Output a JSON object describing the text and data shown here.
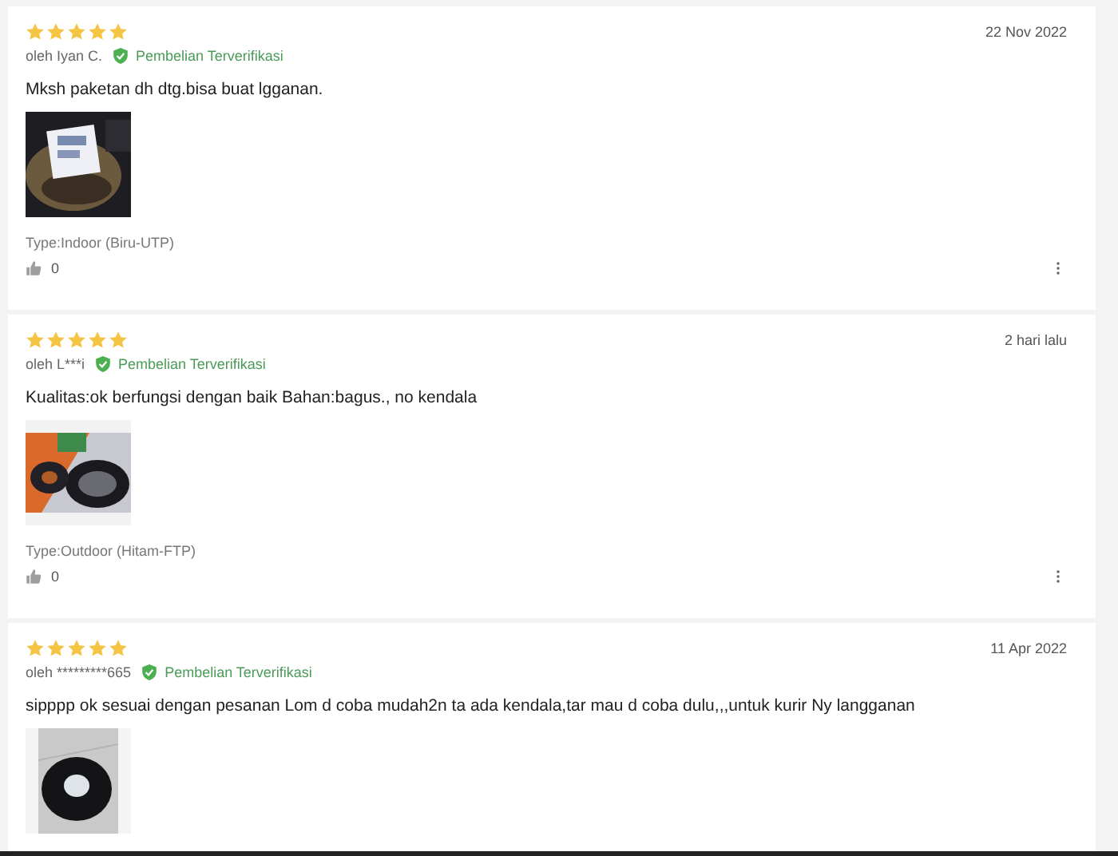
{
  "reviews": [
    {
      "stars": 5,
      "author": "oleh Iyan C.",
      "verified": true,
      "badge": "Pembelian Terverifikasi",
      "date": "22 Nov 2022",
      "text": "Mksh paketan dh dtg.bisa buat lgganan.",
      "variant": "Type:Indoor (Biru-UTP)",
      "likes": "0"
    },
    {
      "stars": 5,
      "author": "oleh L***i",
      "verified": true,
      "badge": "Pembelian Terverifikasi",
      "date": "2 hari lalu",
      "text": "Kualitas:ok berfungsi dengan baik Bahan:bagus., no kendala",
      "variant": "Type:Outdoor (Hitam-FTP)",
      "likes": "0"
    },
    {
      "stars": 5,
      "author": "oleh *********665",
      "verified": true,
      "badge": "Pembelian Terverifikasi",
      "date": "11 Apr 2022",
      "text": "sipppp ok sesuai dengan pesanan Lom d coba mudah2n ta ada kendala,tar mau d coba dulu,,,untuk kurir Ny langganan"
    }
  ]
}
